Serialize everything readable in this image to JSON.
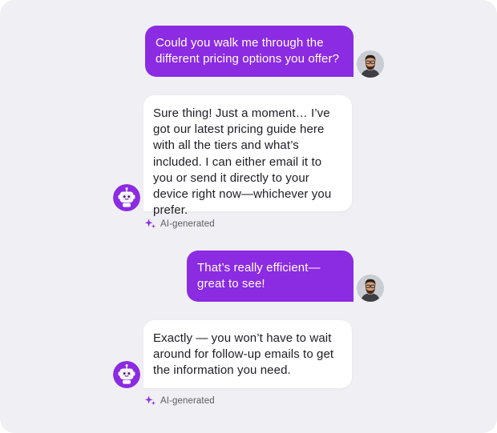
{
  "conversation": {
    "messages": [
      {
        "role": "user",
        "text": "Could you walk me through the different pricing options you offer?"
      },
      {
        "role": "assistant",
        "text": "Sure thing! Just a moment… I’ve got our latest pricing guide here with all the tiers and what’s included. I can either email it to you or send it directly to your device right now—whichever you prefer.",
        "badge": "AI-generated"
      },
      {
        "role": "user",
        "text": "That’s really efficient—great to see!"
      },
      {
        "role": "assistant",
        "text": "Exactly — you won’t have to wait around for follow-up emails to get the information you need.",
        "badge": "AI-generated"
      }
    ]
  },
  "colors": {
    "user_bubble": "#8b2be2",
    "background": "#f0f0f4",
    "bot_avatar": "#8b2be2",
    "sparkle": "#8b2be2"
  },
  "icons": {
    "user_avatar": "user-photo-avatar",
    "bot_avatar": "robot-icon",
    "ai_badge": "sparkle-icon"
  }
}
